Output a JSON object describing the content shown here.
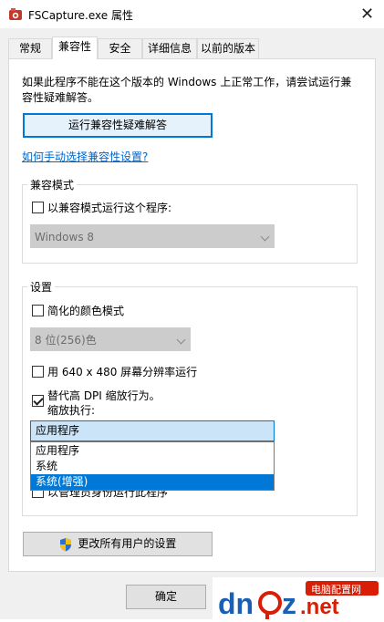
{
  "window": {
    "title": "FSCapture.exe 属性",
    "close_glyph": "✕"
  },
  "tabs": [
    {
      "label": "常规"
    },
    {
      "label": "兼容性"
    },
    {
      "label": "安全"
    },
    {
      "label": "详细信息"
    },
    {
      "label": "以前的版本"
    }
  ],
  "intro": {
    "line1": "如果此程序不能在这个版本的 Windows 上正常工作，请尝试运行兼",
    "line2": "容性疑难解答。"
  },
  "troubleshooter_button": "运行兼容性疑难解答",
  "manual_link": "如何手动选择兼容性设置?",
  "compat_mode": {
    "group_label": "兼容模式",
    "checkbox_label": "以兼容模式运行这个程序:",
    "select_value": "Windows 8"
  },
  "settings": {
    "group_label": "设置",
    "reduced_color_label": "简化的颜色模式",
    "color_select_value": "8 位(256)色",
    "res_640_label": "用 640 x 480 屏幕分辨率运行",
    "dpi_label": "替代高 DPI 缩放行为。",
    "dpi_sub_label": "缩放执行:",
    "dropdown_selected": "应用程序",
    "dropdown_options": [
      "应用程序",
      "系统",
      "系统(增强)"
    ],
    "dropdown_highlight_index": 2,
    "admin_label_partial": "以管理员身份运行此程序"
  },
  "all_users_button": "更改所有用户的设置",
  "ok_button": "确定",
  "watermark": {
    "domain_text": "dnpz.net",
    "site_name": "电脑配置网"
  },
  "colors": {
    "accent": "#0078d7",
    "link": "#0066cc",
    "watermark_blue": "#1a5fb4",
    "watermark_red": "#d81e06"
  },
  "icons": {
    "app": "fscapture-app-icon",
    "shield": "uac-shield-icon",
    "close": "close-icon",
    "chevron": "chevron-down-icon"
  }
}
